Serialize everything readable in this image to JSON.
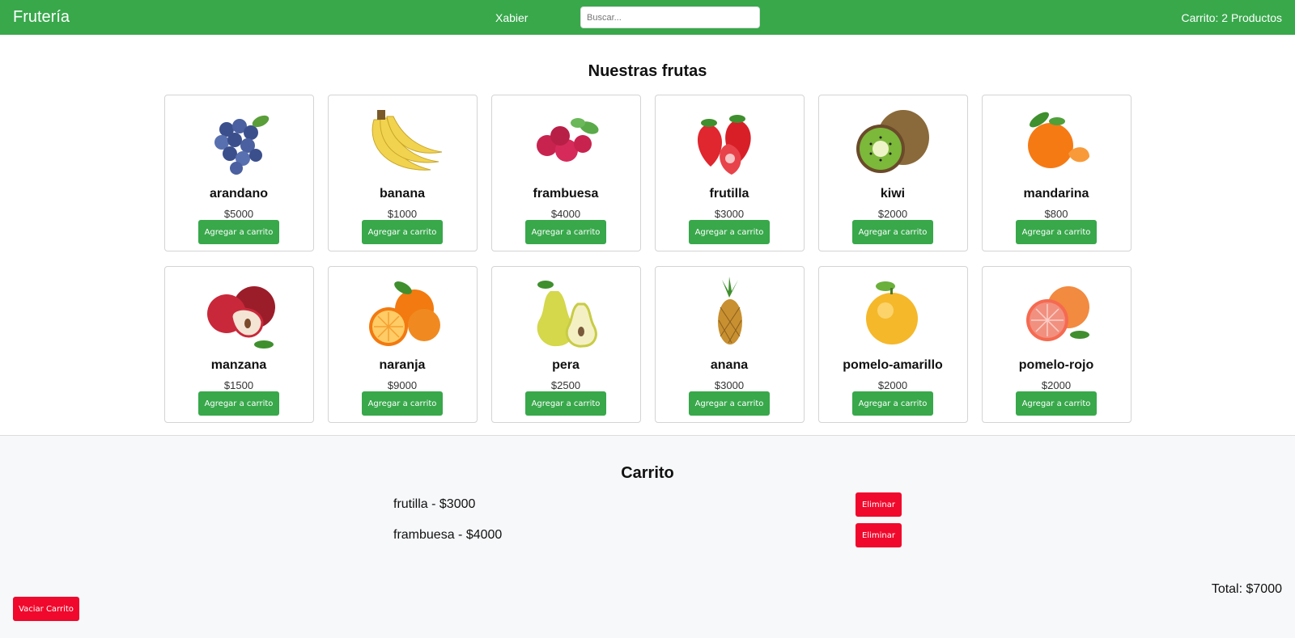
{
  "header": {
    "brand": "Frutería",
    "user": "Xabier",
    "search_placeholder": "Buscar...",
    "cart_count": "Carrito: 2 Productos",
    "bg_color": "#38a84b"
  },
  "catalog": {
    "title": "Nuestras frutas",
    "button_label": "Agregar a carrito",
    "products": [
      {
        "name": "arandano",
        "price": "$5000",
        "image": "blueberries"
      },
      {
        "name": "banana",
        "price": "$1000",
        "image": "bananas"
      },
      {
        "name": "frambuesa",
        "price": "$4000",
        "image": "raspberries"
      },
      {
        "name": "frutilla",
        "price": "$3000",
        "image": "strawberries"
      },
      {
        "name": "kiwi",
        "price": "$2000",
        "image": "kiwi"
      },
      {
        "name": "mandarina",
        "price": "$800",
        "image": "tangerine"
      },
      {
        "name": "manzana",
        "price": "$1500",
        "image": "apples"
      },
      {
        "name": "naranja",
        "price": "$9000",
        "image": "oranges"
      },
      {
        "name": "pera",
        "price": "$2500",
        "image": "pears"
      },
      {
        "name": "anana",
        "price": "$3000",
        "image": "pineapple"
      },
      {
        "name": "pomelo-amarillo",
        "price": "$2000",
        "image": "yellow-grapefruit"
      },
      {
        "name": "pomelo-rojo",
        "price": "$2000",
        "image": "red-grapefruit"
      }
    ]
  },
  "cart": {
    "title": "Carrito",
    "items": [
      {
        "text": "frutilla - $3000",
        "remove_label": "Eliminar"
      },
      {
        "text": "frambuesa - $4000",
        "remove_label": "Eliminar"
      }
    ],
    "empty_label": "Vaciar Carrito",
    "total": "Total: $7000",
    "danger_color": "#f0092c"
  }
}
